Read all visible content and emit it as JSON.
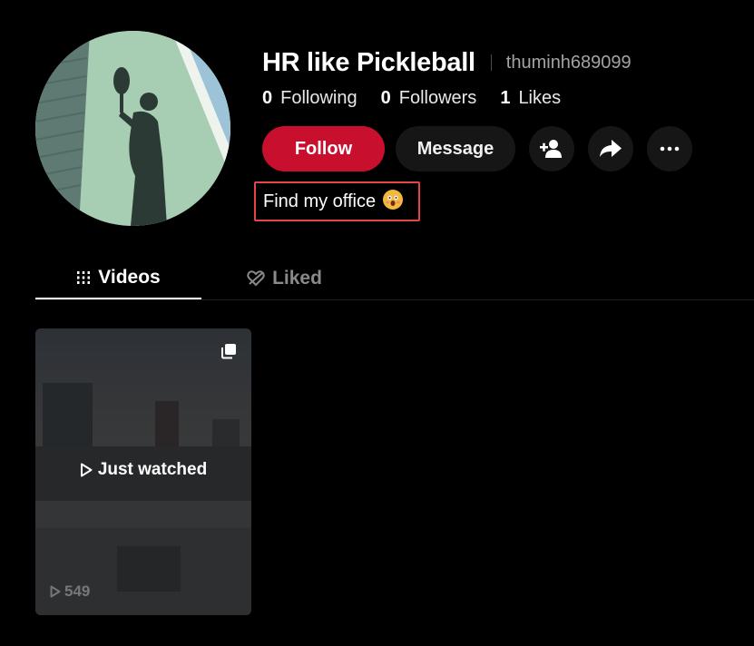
{
  "profile": {
    "display_name": "HR like Pickleball",
    "username": "thuminh689099",
    "bio": "Find my office"
  },
  "stats": [
    {
      "value": "0",
      "label": "Following"
    },
    {
      "value": "0",
      "label": "Followers"
    },
    {
      "value": "1",
      "label": "Likes"
    }
  ],
  "actions": {
    "follow_label": "Follow",
    "message_label": "Message",
    "icons": [
      "add-friend-icon",
      "share-icon",
      "more-icon"
    ]
  },
  "tabs": [
    {
      "label": "Videos",
      "icon": "grid-icon",
      "active": true
    },
    {
      "label": "Liked",
      "icon": "liked-heart-icon",
      "active": false
    }
  ],
  "videos": [
    {
      "overlay_label": "Just watched",
      "views": "549",
      "icon": "multi-photo-icon"
    }
  ],
  "colors": {
    "accent": "#c8102e",
    "highlight_border": "#e2454b",
    "background": "#000000"
  }
}
